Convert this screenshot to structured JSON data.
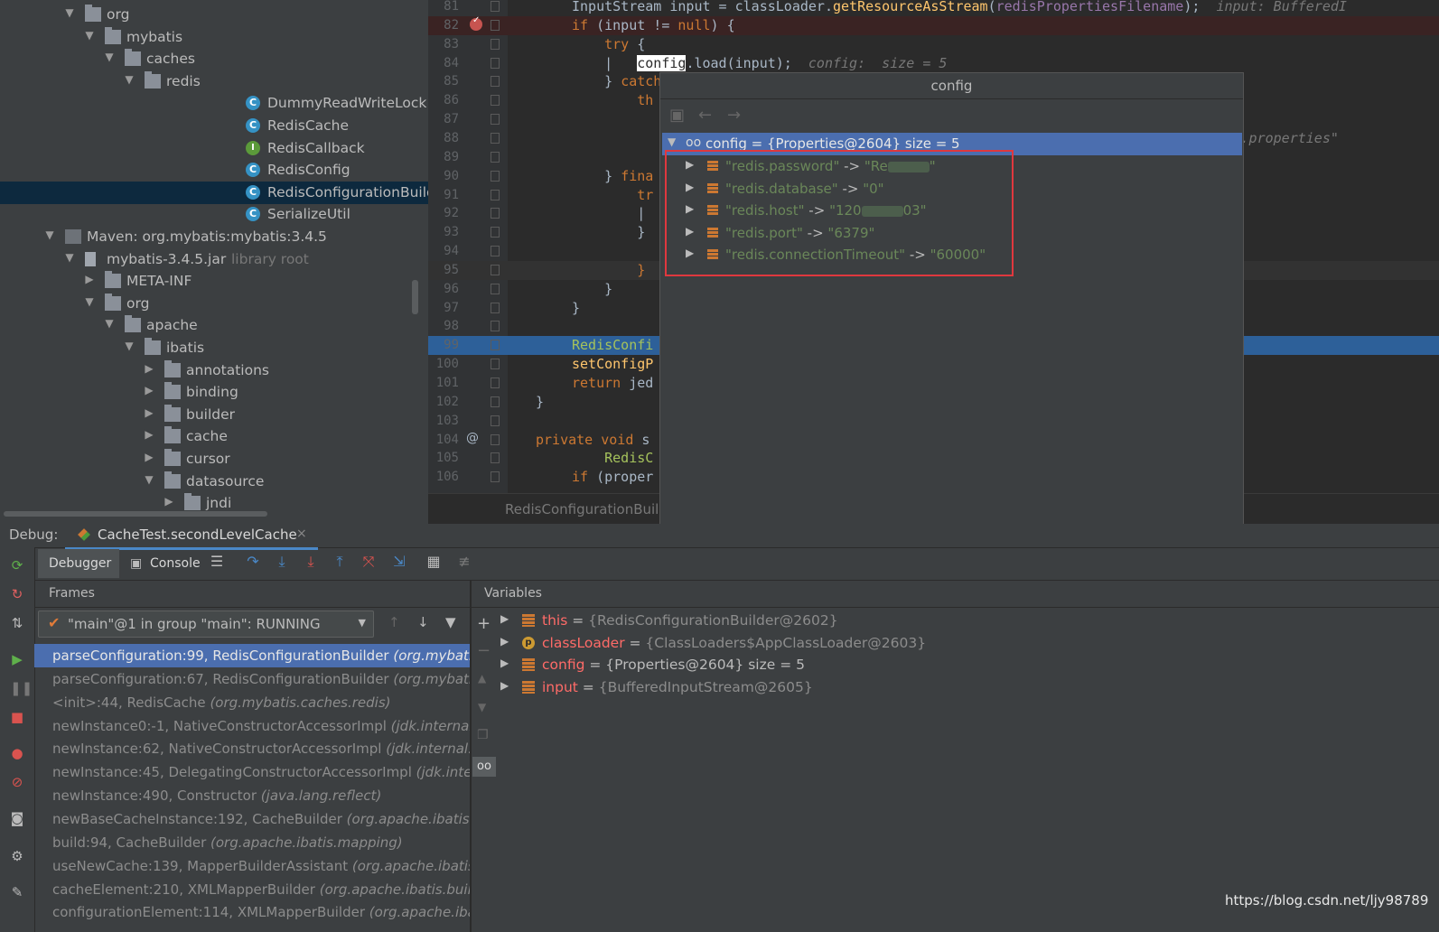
{
  "project_tree": [
    {
      "indent": 0,
      "arrow": "▼",
      "icon": "folder",
      "label": "org"
    },
    {
      "indent": 1,
      "arrow": "▼",
      "icon": "folder",
      "label": "mybatis"
    },
    {
      "indent": 2,
      "arrow": "▼",
      "icon": "folder",
      "label": "caches"
    },
    {
      "indent": 3,
      "arrow": "▼",
      "icon": "folder",
      "label": "redis"
    },
    {
      "indent": 4,
      "arrow": "",
      "icon": "class",
      "label": "DummyReadWriteLock"
    },
    {
      "indent": 4,
      "arrow": "",
      "icon": "class",
      "label": "RedisCache"
    },
    {
      "indent": 4,
      "arrow": "",
      "icon": "interface",
      "label": "RedisCallback"
    },
    {
      "indent": 4,
      "arrow": "",
      "icon": "class",
      "label": "RedisConfig"
    },
    {
      "indent": 4,
      "arrow": "",
      "icon": "class",
      "label": "RedisConfigurationBuilder",
      "selected": true
    },
    {
      "indent": 4,
      "arrow": "",
      "icon": "class",
      "label": "SerializeUtil"
    },
    {
      "indent": -1,
      "arrow": "▼",
      "icon": "maven",
      "label": "Maven: org.mybatis:mybatis:3.4.5"
    },
    {
      "indent": 0,
      "arrow": "▼",
      "icon": "jar",
      "label": "mybatis-3.4.5.jar",
      "suffix": "library root"
    },
    {
      "indent": 1,
      "arrow": "▶",
      "icon": "folder",
      "label": "META-INF"
    },
    {
      "indent": 1,
      "arrow": "▼",
      "icon": "folder",
      "label": "org"
    },
    {
      "indent": 2,
      "arrow": "▼",
      "icon": "folder",
      "label": "apache"
    },
    {
      "indent": 3,
      "arrow": "▼",
      "icon": "folder",
      "label": "ibatis"
    },
    {
      "indent": 4,
      "arrow": "▶",
      "icon": "folder",
      "label": "annotations"
    },
    {
      "indent": 4,
      "arrow": "▶",
      "icon": "folder",
      "label": "binding"
    },
    {
      "indent": 4,
      "arrow": "▶",
      "icon": "folder",
      "label": "builder"
    },
    {
      "indent": 4,
      "arrow": "▶",
      "icon": "folder",
      "label": "cache"
    },
    {
      "indent": 4,
      "arrow": "▶",
      "icon": "folder",
      "label": "cursor"
    },
    {
      "indent": 4,
      "arrow": "▼",
      "icon": "folder",
      "label": "datasource"
    },
    {
      "indent": 5,
      "arrow": "▶",
      "icon": "folder",
      "label": "jndi"
    }
  ],
  "editor": {
    "lines": [
      {
        "n": "81",
        "html": "<span class='typ'>InputStream</span> input = classLoader.<span style='color:#ffc66d'>getResourceAsStream</span>(<span class='fld'>redisPropertiesFilename</span>);  <span class='hint'>input: BufferedI</span>"
      },
      {
        "n": "82",
        "html": "<span class='kw'>if</span> (input != <span class='kw'>null</span>) {",
        "hl": "break",
        "bp": true
      },
      {
        "n": "83",
        "html": "    <span class='kw'>try</span> {"
      },
      {
        "n": "84",
        "html": "    |   <span class='sel-word'>config</span>.load(input);  <span class='hint'>config:  size = 5</span>"
      },
      {
        "n": "85",
        "html": "    } <span class='kw'>catch</span>"
      },
      {
        "n": "86",
        "html": "        <span class='kw'>th</span>"
      },
      {
        "n": "87",
        "html": ""
      },
      {
        "n": "88",
        "html": "                                                                            <span class='hint'>\"redis.properties\"</span>"
      },
      {
        "n": "89",
        "html": ""
      },
      {
        "n": "90",
        "html": "    } <span class='kw'>fina</span>"
      },
      {
        "n": "91",
        "html": "        <span class='kw'>tr</span>"
      },
      {
        "n": "92",
        "html": "        |"
      },
      {
        "n": "93",
        "html": "        }"
      },
      {
        "n": "94",
        "html": ""
      },
      {
        "n": "95",
        "html": "        <span class='kw'>}</span>",
        "hl": "caret"
      },
      {
        "n": "96",
        "html": "    }"
      },
      {
        "n": "97",
        "html": "}"
      },
      {
        "n": "98",
        "html": ""
      },
      {
        "n": "99",
        "html": "<span style='color:#a5c25c'>RedisConfi</span>",
        "hl": "exec"
      },
      {
        "n": "100",
        "html": "<span style='color:#ffc66d'>setConfigP</span>"
      },
      {
        "n": "101",
        "html": "<span class='kw'>return</span> jed"
      },
      {
        "n": "102",
        "html": "}",
        "outdent": true
      },
      {
        "n": "103",
        "html": ""
      },
      {
        "n": "104",
        "html": "<span class='kw'>private void</span> s",
        "outdent": true,
        "at": true
      },
      {
        "n": "105",
        "html": "    <span style='color:#a5c25c'>RedisC</span>"
      },
      {
        "n": "106",
        "html": "<span class='kw'>if</span> (proper"
      }
    ],
    "tab_label": "RedisConfigurationBuild"
  },
  "popup": {
    "title": "config",
    "root": "config = {Properties@2604}  size = 5",
    "entries": [
      {
        "key": "\"redis.password\"",
        "arrow": " -> ",
        "value_prefix": "\"Re",
        "value_suffix": "\"",
        "blurred": true
      },
      {
        "key": "\"redis.database\"",
        "arrow": " -> ",
        "value_prefix": "\"0\"",
        "value_suffix": "",
        "blurred": false
      },
      {
        "key": "\"redis.host\"",
        "arrow": " -> ",
        "value_prefix": "\"120",
        "value_suffix": "03\"",
        "blurred": true
      },
      {
        "key": "\"redis.port\"",
        "arrow": " -> ",
        "value_prefix": "\"6379\"",
        "value_suffix": "",
        "blurred": false
      },
      {
        "key": "\"redis.connectionTimeout\"",
        "arrow": " -> ",
        "value_prefix": "\"60000\"",
        "value_suffix": "",
        "blurred": false
      }
    ]
  },
  "debug": {
    "label": "Debug:",
    "session_tab": "CacheTest.secondLevelCache",
    "subtabs": {
      "debugger": "Debugger",
      "console": "Console"
    },
    "frames_title": "Frames",
    "variables_title": "Variables",
    "thread": "\"main\"@1 in group \"main\": RUNNING",
    "frames": [
      {
        "method": "parseConfiguration:99, RedisConfigurationBuilder ",
        "pkg": "(org.mybatis.c",
        "selected": true
      },
      {
        "method": "parseConfiguration:67, RedisConfigurationBuilder ",
        "pkg": "(org.mybatis.c"
      },
      {
        "method": "<init>:44, RedisCache ",
        "pkg": "(org.mybatis.caches.redis)"
      },
      {
        "method": "newInstance0:-1, NativeConstructorAccessorImpl ",
        "pkg": "(jdk.internal.re"
      },
      {
        "method": "newInstance:62, NativeConstructorAccessorImpl ",
        "pkg": "(jdk.internal.ref"
      },
      {
        "method": "newInstance:45, DelegatingConstructorAccessorImpl ",
        "pkg": "(jdk.interna"
      },
      {
        "method": "newInstance:490, Constructor ",
        "pkg": "(java.lang.reflect)"
      },
      {
        "method": "newBaseCacheInstance:192, CacheBuilder ",
        "pkg": "(org.apache.ibatis.map"
      },
      {
        "method": "build:94, CacheBuilder ",
        "pkg": "(org.apache.ibatis.mapping)"
      },
      {
        "method": "useNewCache:139, MapperBuilderAssistant ",
        "pkg": "(org.apache.ibatis.bu"
      },
      {
        "method": "cacheElement:210, XMLMapperBuilder ",
        "pkg": "(org.apache.ibatis.builde"
      },
      {
        "method": "configurationElement:114, XMLMapperBuilder ",
        "pkg": "(org.apache.ibati"
      }
    ],
    "variables": [
      {
        "icon": "lines",
        "name": "this",
        "value": "{RedisConfigurationBuilder@2602}"
      },
      {
        "icon": "p",
        "name": "classLoader",
        "value": "{ClassLoaders$AppClassLoader@2603}"
      },
      {
        "icon": "lines",
        "name": "config",
        "value": "{Properties@2604}  size = 5",
        "extra_white": true
      },
      {
        "icon": "lines",
        "name": "input",
        "value": "{BufferedInputStream@2605}"
      }
    ]
  },
  "watermark": "https://blog.csdn.net/ljy98789"
}
